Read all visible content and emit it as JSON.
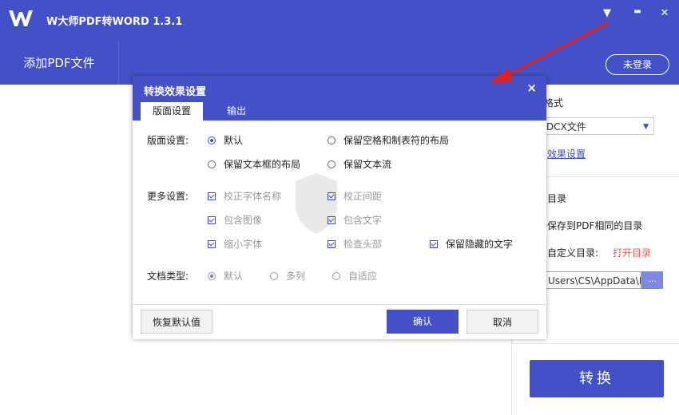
{
  "app": {
    "title": "W大师PDF转WORD 1.3.1",
    "logo_icon": "w-logo-icon",
    "accent": "#4350c8",
    "controls": {
      "menu": "▼",
      "minimize": "▬",
      "close": "✕"
    }
  },
  "toolbar": {
    "add_pdf": "添加PDF文件",
    "login": "未登录"
  },
  "right_panel": {
    "format_label": "格式",
    "format_value": "DCX文件",
    "effect_link": "效果设置",
    "dir_label": "目录",
    "save_same_dir": "保存到PDF相同的目录",
    "custom_dir": "自定义目录:",
    "open_dir": "打开目录",
    "path_value": "Users\\CS\\AppData\\I",
    "browse": "...",
    "convert": "转换"
  },
  "dialog": {
    "title": "转换效果设置",
    "close": "×",
    "tabs": [
      "版面设置",
      "输出"
    ],
    "layout": {
      "label": "版面设置:",
      "options": [
        "默认",
        "保留空格和制表符的布局",
        "保留文本框的布局",
        "保留文本流"
      ]
    },
    "more": {
      "label": "更多设置:",
      "options": [
        "校正字体名称",
        "校正间距",
        "包含图像",
        "包含文字",
        "缩小字体",
        "检查头部",
        "保留隐藏的文字"
      ]
    },
    "doctype": {
      "label": "文档类型:",
      "options": [
        "默认",
        "多列",
        "自适应"
      ]
    },
    "buttons": {
      "reset": "恢复默认值",
      "ok": "确认",
      "cancel": "取消"
    }
  }
}
